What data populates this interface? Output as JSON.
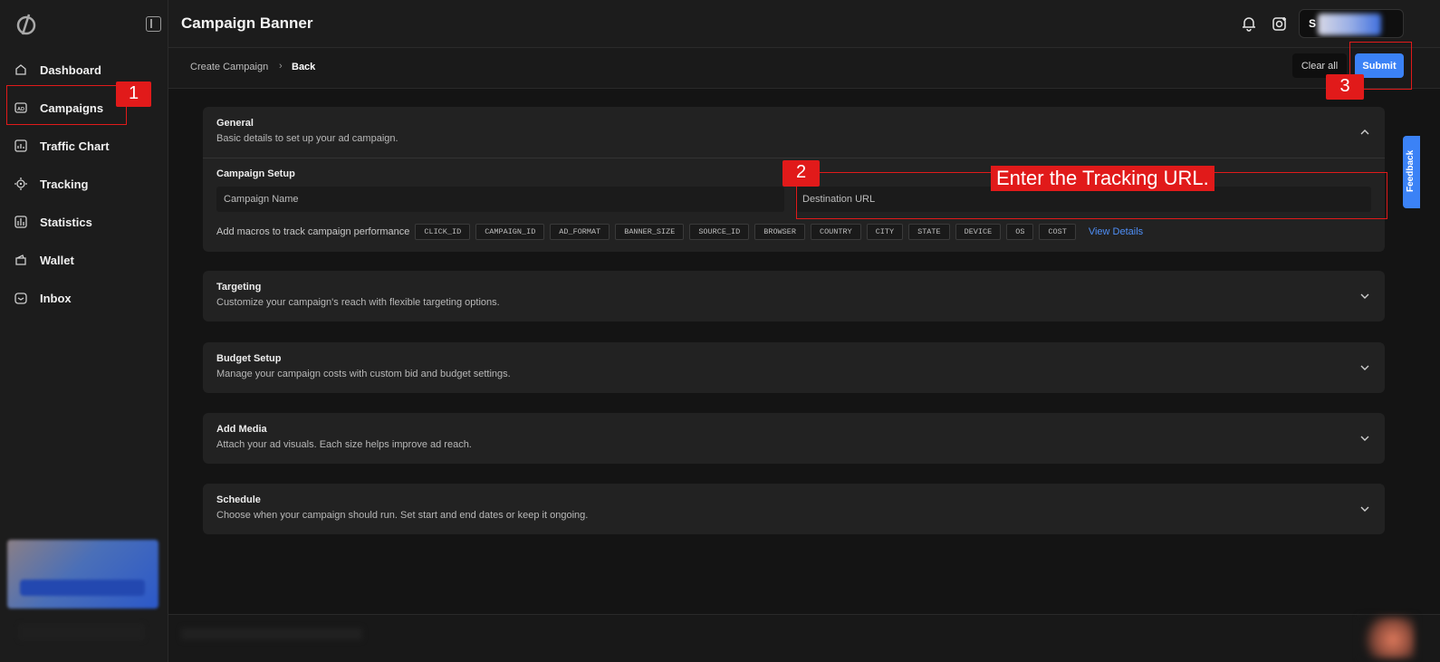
{
  "app": {
    "logo_icon": "logo-icon",
    "collapse_icon": "collapse-sidebar-icon"
  },
  "sidebar": {
    "items": [
      {
        "label": "Dashboard",
        "icon": "home-icon"
      },
      {
        "label": "Campaigns",
        "icon": "ad-icon"
      },
      {
        "label": "Traffic Chart",
        "icon": "chart-icon"
      },
      {
        "label": "Tracking",
        "icon": "target-icon"
      },
      {
        "label": "Statistics",
        "icon": "stats-icon"
      },
      {
        "label": "Wallet",
        "icon": "wallet-icon"
      },
      {
        "label": "Inbox",
        "icon": "inbox-icon"
      }
    ]
  },
  "header": {
    "title": "Campaign Banner",
    "user_initial": "S"
  },
  "breadcrumb": {
    "parent": "Create Campaign",
    "current": "Back"
  },
  "actions": {
    "clear_label": "Clear all",
    "submit_label": "Submit"
  },
  "general": {
    "title": "General",
    "subtitle": "Basic details to set up your ad campaign.",
    "setup_title": "Campaign Setup",
    "name_placeholder": "Campaign Name",
    "url_placeholder": "Destination URL",
    "macros_label": "Add macros to track campaign performance",
    "macros": [
      "CLICK_ID",
      "CAMPAIGN_ID",
      "AD_FORMAT",
      "BANNER_SIZE",
      "SOURCE_ID",
      "BROWSER",
      "COUNTRY",
      "CITY",
      "STATE",
      "DEVICE",
      "OS",
      "COST"
    ],
    "view_details": "View Details"
  },
  "sections": [
    {
      "title": "Targeting",
      "subtitle": "Customize your campaign's reach with flexible targeting options."
    },
    {
      "title": "Budget Setup",
      "subtitle": "Manage your campaign costs with custom bid and budget settings."
    },
    {
      "title": "Add Media",
      "subtitle": "Attach your ad visuals. Each size helps improve ad reach."
    },
    {
      "title": "Schedule",
      "subtitle": "Choose when your campaign should run. Set start and end dates or keep it ongoing."
    }
  ],
  "annotations": {
    "n1": "1",
    "n2": "2",
    "n3": "3",
    "callout": "Enter the Tracking URL.",
    "color": "#e11a1a"
  },
  "feedback": {
    "label": "Feedback"
  },
  "colors": {
    "accent": "#3b82f6",
    "background": "#141414",
    "panel": "#222222"
  }
}
